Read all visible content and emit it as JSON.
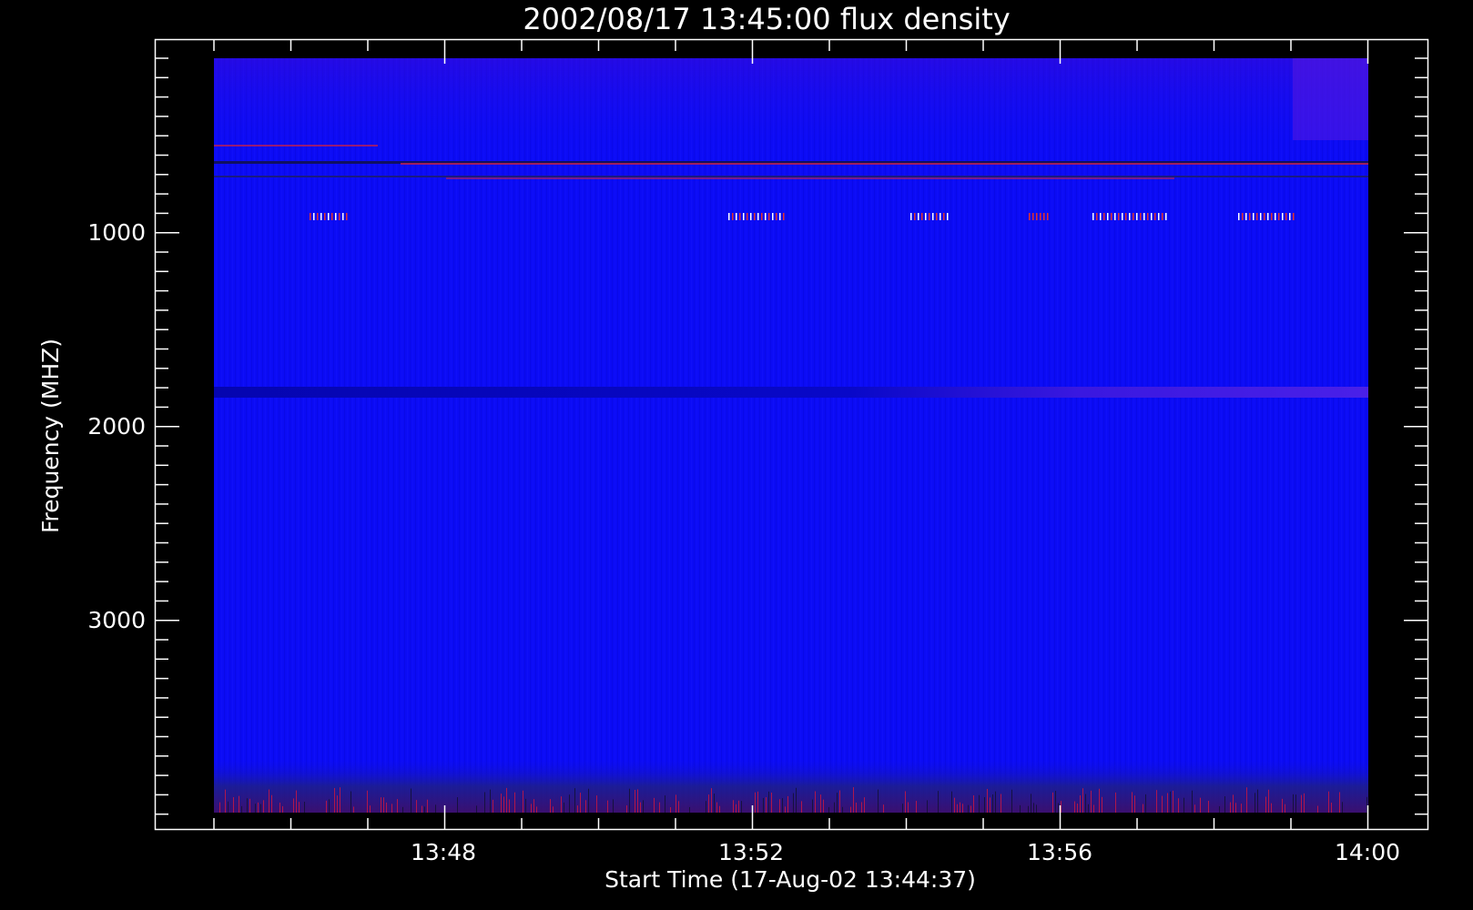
{
  "chart_data": {
    "type": "heatmap",
    "title": "2002/08/17 13:45:00 flux density",
    "xlabel": "Start Time (17-Aug-02 13:44:37)",
    "ylabel": "Frequency (MHZ)",
    "x_ticks": [
      "13:48",
      "13:52",
      "13:56",
      "14:00"
    ],
    "y_ticks": [
      "1000",
      "2000",
      "3000"
    ],
    "x_range_minutes": [
      0,
      16.9
    ],
    "y_range_mhz": [
      100,
      4400
    ],
    "colors": {
      "background": "#000000",
      "axes": "#ffffff",
      "base": "#0b0bf5",
      "dark_band": "#0a0ac8",
      "burst": "#ff2020"
    },
    "features": [
      {
        "kind": "dark_line",
        "freq_mhz": 640
      },
      {
        "kind": "dark_line",
        "freq_mhz": 720
      },
      {
        "kind": "dark_band",
        "freq_mhz": 1840
      },
      {
        "kind": "noise_band",
        "freq_mhz": 4200
      }
    ]
  }
}
